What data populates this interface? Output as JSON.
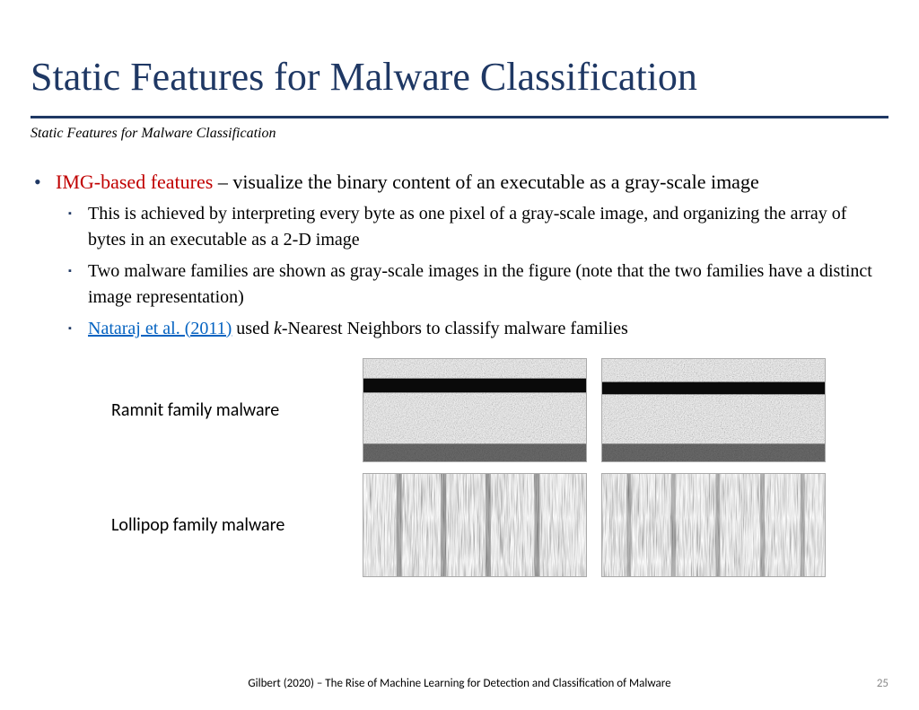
{
  "title": "Static Features for Malware Classification",
  "subtitle": "Static Features for Malware Classification",
  "bullet": {
    "highlight": "IMG-based features",
    "rest": " – visualize the binary content of an executable as a gray-scale image"
  },
  "sub": [
    "This is achieved by interpreting every byte as one pixel of a gray-scale image, and organizing the array of bytes in an executable as a 2-D image",
    "Two malware families are shown as gray-scale images in the figure (note that the two families have a distinct image representation)"
  ],
  "sub3": {
    "link": "Nataraj et al. (2011)",
    "mid": " used ",
    "k": "k",
    "rest": "-Nearest Neighbors to classify malware families"
  },
  "rows": [
    {
      "label": "Ramnit family malware"
    },
    {
      "label": "Lollipop family malware"
    }
  ],
  "footer": "Gilbert (2020) – The Rise of Machine Learning for Detection and Classification of Malware",
  "page": "25"
}
